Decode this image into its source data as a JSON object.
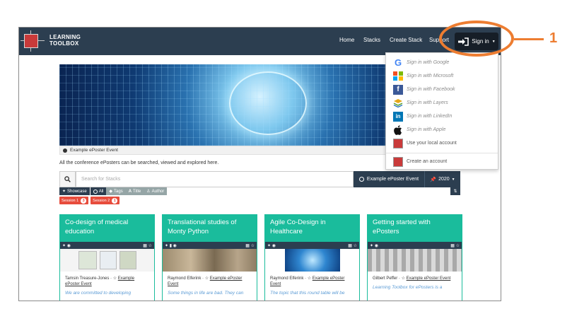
{
  "app": {
    "logo_line1": "LEARNING",
    "logo_line2": "TOOLBOX"
  },
  "nav": {
    "home": "Home",
    "stacks": "Stacks",
    "create_stack": "Create Stack",
    "support": "Support",
    "signin": "Sign in",
    "signin_icon": "sign-in-icon"
  },
  "signin_menu": {
    "google": "Sign in with Google",
    "microsoft": "Sign in with Microsoft",
    "facebook": "Sign in with Facebook",
    "layers": "Sign in with Layers",
    "linkedin": "Sign in with LinkedIn",
    "apple": "Sign in with Apple",
    "local": "Use your local account",
    "create": "Create an account"
  },
  "banner": {
    "caption": "Example ePoster Event"
  },
  "intro_text": "All the conference ePosters can be searched, viewed and explored here.",
  "search": {
    "placeholder": "Search for Stacks",
    "event_label": "Example ePoster Event",
    "year_label": "2020"
  },
  "filters": {
    "showcase": "Showcase",
    "all": "All",
    "tags": "Tags",
    "title": "Title",
    "author": "Author"
  },
  "sessions": [
    {
      "label": "Session 1",
      "count": "3"
    },
    {
      "label": "Session 2",
      "count": "1"
    }
  ],
  "cards": [
    {
      "title": "Co-design of medical education",
      "author": "Tamsin Treasure-Jones · ",
      "event": "Example ePoster Event",
      "desc": "We are committed to developing"
    },
    {
      "title": "Translational studies of Monty Python",
      "author": "Raymond Elferink · ",
      "event": "Example ePoster Event",
      "desc": "Some things in life are bad. They can"
    },
    {
      "title": "Agile Co-Design in Healthcare",
      "author": "Raymond Elferink · ",
      "event": "Example ePoster Event",
      "desc": "The topic that this round table will be"
    },
    {
      "title": "Getting started with ePosters",
      "author": "Gilbert Peffer · ",
      "event": "Example ePoster Event",
      "desc": "Learning Toolbox for ePosters is a"
    }
  ],
  "annotation": {
    "number": "1",
    "color": "#ed7d31"
  },
  "colors": {
    "navbar": "#2c3e50",
    "accent_green": "#1abc9c",
    "session_red": "#e74c3c",
    "filter_grey": "#95a5a6"
  }
}
